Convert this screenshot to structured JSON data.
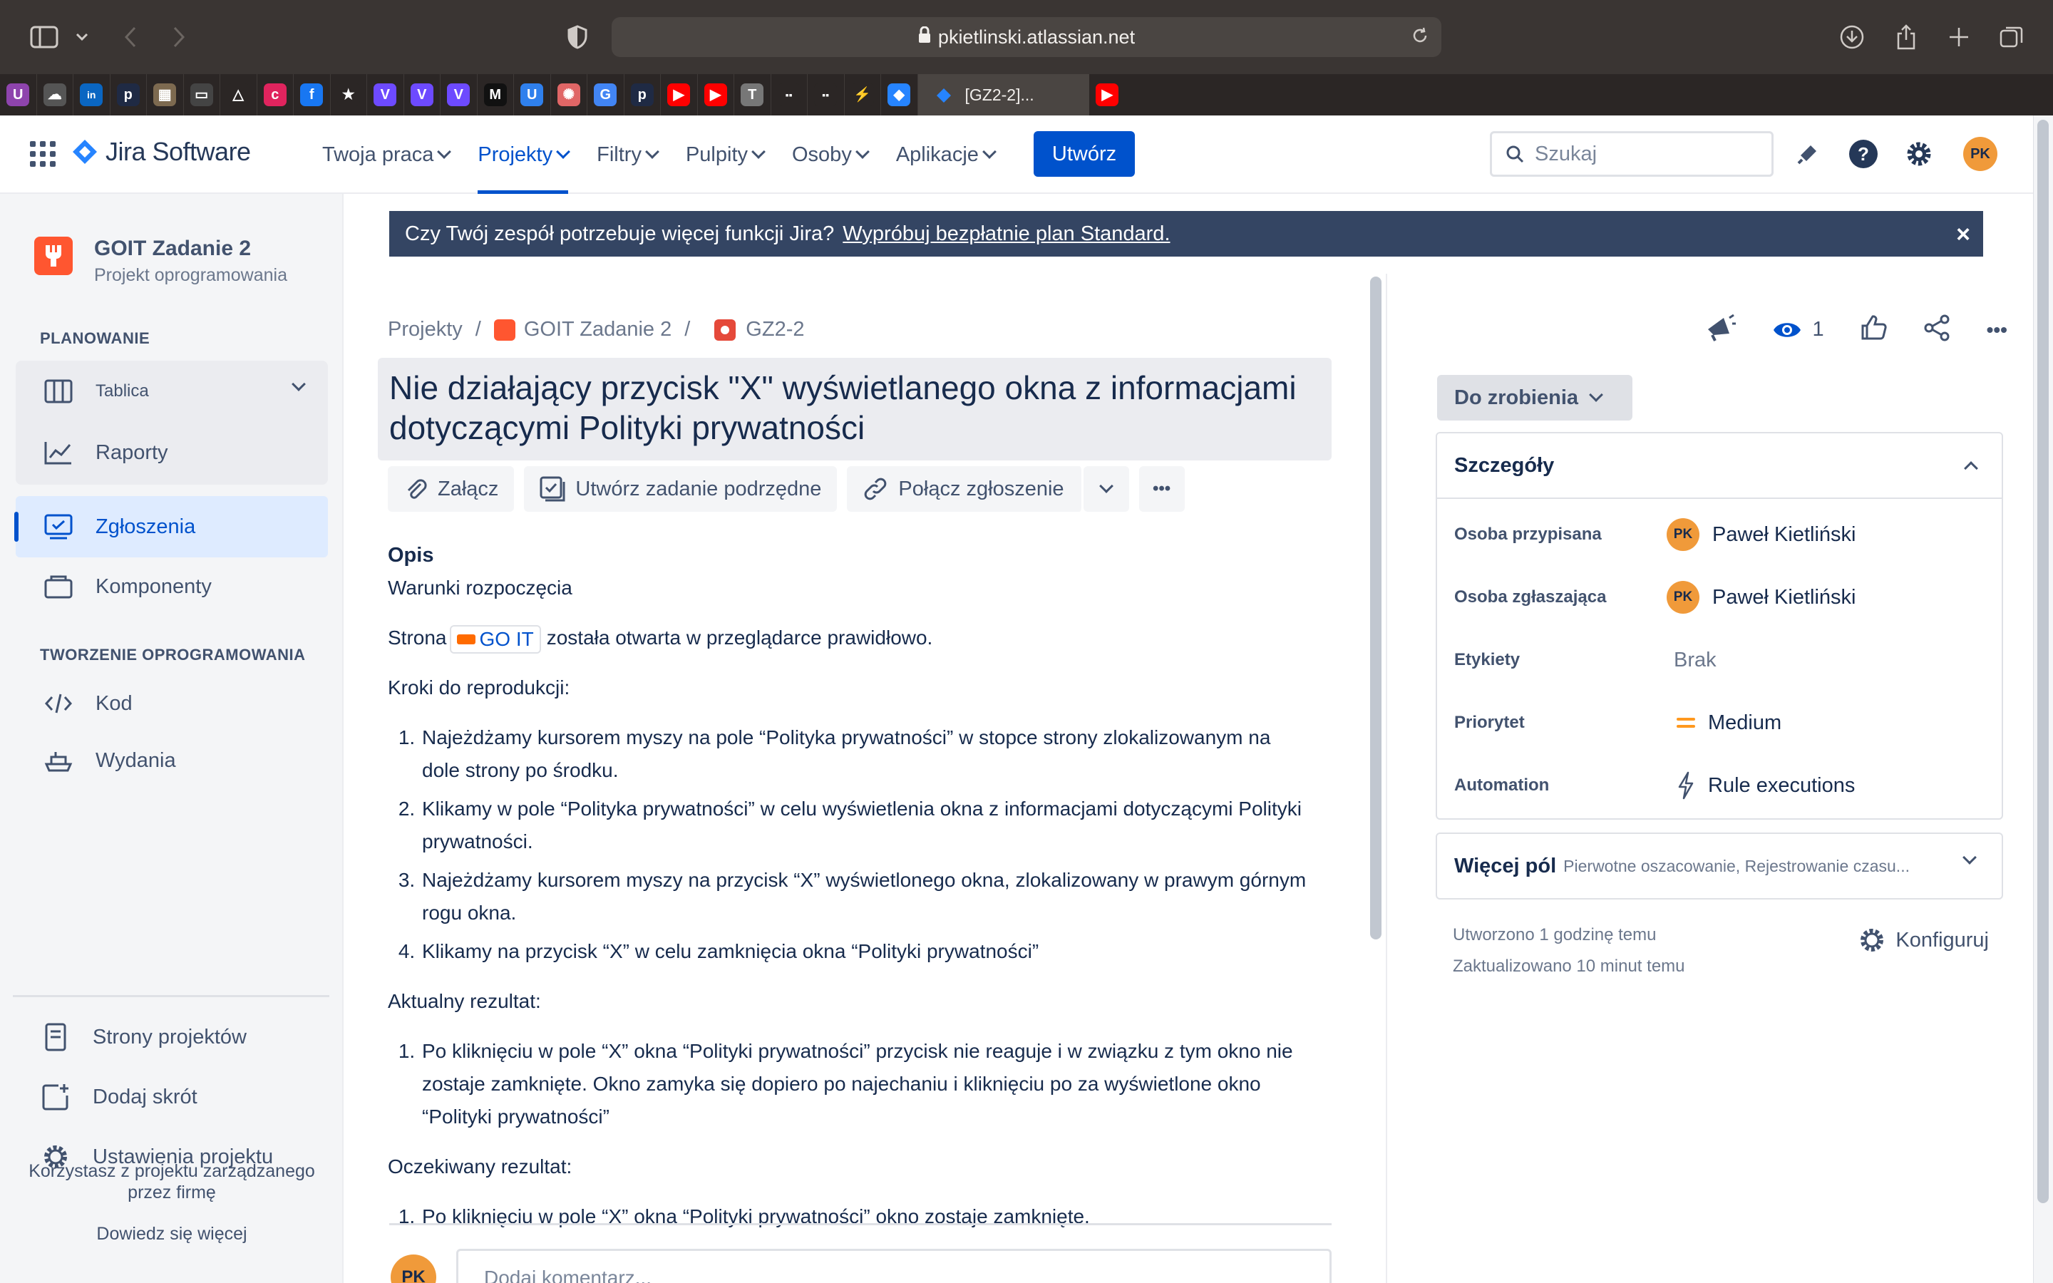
{
  "browser": {
    "url": "pkietlinski.atlassian.net",
    "active_tab_title": "[GZ2-2]..."
  },
  "favorites": [
    {
      "icon": "u-app-icon",
      "letter": "U",
      "color": "#8e44ad"
    },
    {
      "icon": "cloud-icon",
      "letter": "☁",
      "color": "#555555"
    },
    {
      "icon": "linkedin-icon",
      "letter": "in",
      "color": "#0a66c2"
    },
    {
      "icon": "p-icon",
      "letter": "p",
      "color": "#1f2a44"
    },
    {
      "icon": "image-icon",
      "letter": "▦",
      "color": "#7d6a50"
    },
    {
      "icon": "tablet-icon",
      "letter": "▭",
      "color": "#444444"
    },
    {
      "icon": "triangle-icon",
      "letter": "△",
      "color": "#2b2625"
    },
    {
      "icon": "pink-app-icon",
      "letter": "c",
      "color": "#e0245e"
    },
    {
      "icon": "facebook-icon",
      "letter": "f",
      "color": "#1877f2"
    },
    {
      "icon": "star-icon",
      "letter": "★",
      "color": "#2b2625"
    },
    {
      "icon": "proton-icon",
      "letter": "V",
      "color": "#6d4aff"
    },
    {
      "icon": "proton-icon",
      "letter": "V",
      "color": "#6d4aff"
    },
    {
      "icon": "proton-icon",
      "letter": "V",
      "color": "#6d4aff"
    },
    {
      "icon": "m-icon",
      "letter": "M",
      "color": "#111111"
    },
    {
      "icon": "u-circle-icon",
      "letter": "U",
      "color": "#2f80ed"
    },
    {
      "icon": "openai-icon",
      "letter": "✺",
      "color": "#e06666"
    },
    {
      "icon": "translate-icon",
      "letter": "G",
      "color": "#4285f4"
    },
    {
      "icon": "p-icon",
      "letter": "p",
      "color": "#1f2a44"
    },
    {
      "icon": "youtube-icon",
      "letter": "▶",
      "color": "#ff0000"
    },
    {
      "icon": "youtube-icon",
      "letter": "▶",
      "color": "#ff0000"
    },
    {
      "icon": "t-icon",
      "letter": "T",
      "color": "#777777"
    },
    {
      "icon": "goit-icon",
      "letter": "▪▪",
      "color": "#2b2625"
    },
    {
      "icon": "goit-icon",
      "letter": "▪▪",
      "color": "#2b2625"
    },
    {
      "icon": "bolt-icon",
      "letter": "⚡",
      "color": "#2b2625"
    },
    {
      "icon": "jira-icon",
      "letter": "◆",
      "color": "#2684ff"
    }
  ],
  "header": {
    "product": "Jira Software",
    "nav": [
      {
        "label": "Twoja praca",
        "active": false
      },
      {
        "label": "Projekty",
        "active": true
      },
      {
        "label": "Filtry",
        "active": false
      },
      {
        "label": "Pulpity",
        "active": false
      },
      {
        "label": "Osoby",
        "active": false
      },
      {
        "label": "Aplikacje",
        "active": false
      }
    ],
    "create_label": "Utwórz",
    "search_placeholder": "Szukaj",
    "user_initials": "PK"
  },
  "sidebar": {
    "project_name": "GOIT Zadanie 2",
    "project_type": "Projekt oprogramowania",
    "planning_title": "PLANOWANIE",
    "board_label": "Tablica",
    "reports_label": "Raporty",
    "issues_label": "Zgłoszenia",
    "components_label": "Komponenty",
    "dev_title": "TWORZENIE OPROGRAMOWANIA",
    "code_label": "Kod",
    "releases_label": "Wydania",
    "pages_label": "Strony projektów",
    "shortcut_label": "Dodaj skrót",
    "settings_label": "Ustawienia projektu",
    "footer_text": "Korzystasz z projektu zarządzanego przez firmę",
    "learn_more": "Dowiedz się więcej"
  },
  "banner": {
    "text": "Czy Twój zespół potrzebuje więcej funkcji Jira?",
    "link": "Wypróbuj bezpłatnie plan Standard.",
    "close": "×"
  },
  "issue": {
    "breadcrumbs": [
      "Projekty",
      "/",
      "GOIT Zadanie 2",
      "/",
      "GZ2-2"
    ],
    "title": "Nie działający przycisk \"X\" wyświetlanego okna z informacjami dotyczącymi Polityki prywatności",
    "actions": {
      "attach": "Załącz",
      "subtask": "Utwórz zadanie podrzędne",
      "link": "Połącz zgłoszenie",
      "more": "•••"
    },
    "description": {
      "heading": "Opis",
      "preconditions_title": "Warunki rozpoczęcia",
      "pre_before": "Strona",
      "pre_link": "GO IT",
      "pre_after": "została otwarta w przeglądarce prawidłowo.",
      "steps_title": "Kroki do reprodukcji:",
      "steps": [
        "Najeżdżamy kursorem myszy na pole “Polityka prywatności” w stopce strony zlokalizowanym na dole strony po środku.",
        "Klikamy w pole “Polityka prywatności” w celu wyświetlenia okna z informacjami dotyczącymi Polityki prywatności.",
        "Najeżdżamy kursorem myszy na przycisk “X” wyświetlonego okna, zlokalizowany w prawym górnym rogu okna.",
        "Klikamy na przycisk “X” w celu zamknięcia okna “Polityki prywatności”"
      ],
      "actual_title": "Aktualny rezultat:",
      "actual": [
        "Po kliknięciu w pole “X” okna “Polityki prywatności”  przycisk nie reaguje i w związku z tym okno nie zostaje zamknięte. Okno zamyka się dopiero po najechaniu i kliknięciu po za wyświetlone okno “Polityki prywatności”"
      ],
      "expected_title": "Oczekiwany rezultat:",
      "expected": [
        "Po kliknięciu w pole “X” okna “Polityki prywatności” okno zostaje zamknięte."
      ]
    },
    "comment_placeholder": "Dodaj komentarz..."
  },
  "details": {
    "watchers": "1",
    "status": "Do zrobienia",
    "section_title": "Szczegóły",
    "fields": {
      "assignee_label": "Osoba przypisana",
      "assignee": "Paweł Kietliński",
      "reporter_label": "Osoba zgłaszająca",
      "reporter": "Paweł Kietliński",
      "labels_label": "Etykiety",
      "labels": "Brak",
      "priority_label": "Priorytet",
      "priority": "Medium",
      "automation_label": "Automation",
      "automation": "Rule executions"
    },
    "more_title": "Więcej pól",
    "more_subtitle": "Pierwotne oszacowanie, Rejestrowanie czasu...",
    "created": "Utworzono 1 godzinę temu",
    "updated": "Zaktualizowano 10 minut temu",
    "configure": "Konfiguruj"
  },
  "colors": {
    "accent": "#0052cc",
    "priority_medium": "#ff991f",
    "avatar": "#f09a3a"
  }
}
